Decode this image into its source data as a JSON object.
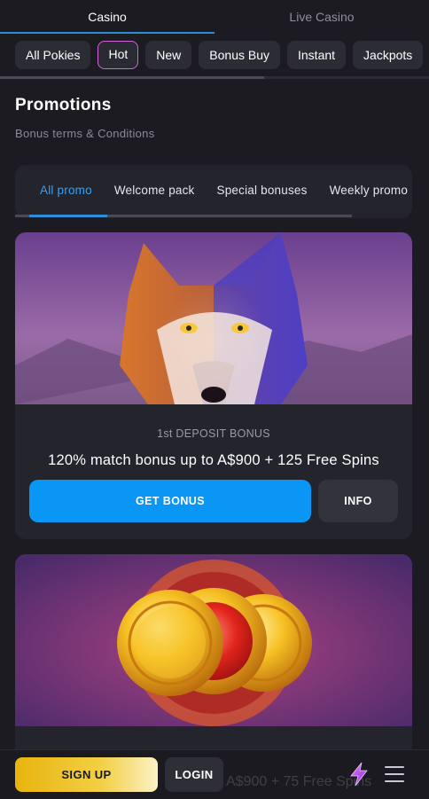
{
  "top_tabs": [
    "Casino",
    "Live Casino"
  ],
  "chips": [
    "All Pokies",
    "Hot",
    "New",
    "Bonus Buy",
    "Instant",
    "Jackpots"
  ],
  "promotions": {
    "title": "Promotions",
    "terms_link": "Bonus terms & Conditions"
  },
  "subtabs": [
    "All promo",
    "Welcome pack",
    "Special bonuses",
    "Weekly promo"
  ],
  "cards": [
    {
      "image_icon": "wolf-illustration",
      "label": "1st DEPOSIT BONUS",
      "headline": "120% match bonus up to A$900 + 125 Free Spins",
      "get_bonus": "GET BONUS",
      "info": "INFO"
    },
    {
      "image_icon": "gold-coins-illustration"
    }
  ],
  "bottom_bar": {
    "ghost_text": "A$900 + 75 Free Spins",
    "signup": "SIGN UP",
    "login": "LOGIN"
  },
  "colors": {
    "accent_blue": "#0a96f5",
    "active_tab_blue": "#3a9ff0",
    "hot_chip_border": "#d064d8",
    "signup_gold": "#f3cf45",
    "background": "#1b1b21"
  }
}
